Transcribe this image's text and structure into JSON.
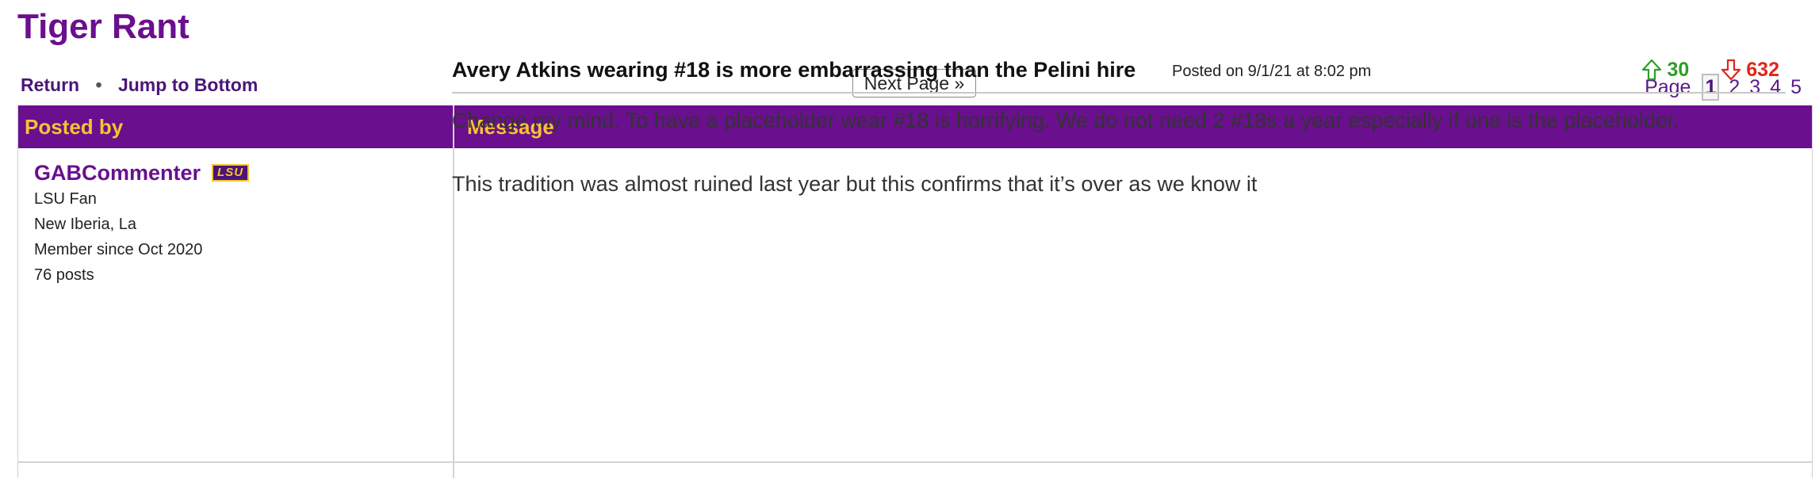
{
  "forum": {
    "title": "Tiger Rant"
  },
  "nav": {
    "return_label": "Return",
    "separator": "•",
    "jump_label": "Jump to Bottom"
  },
  "pager": {
    "next_label": "Next Page »",
    "page_label": "Page",
    "pages": [
      "1",
      "2",
      "3",
      "4",
      "5"
    ],
    "current": "1"
  },
  "table": {
    "posted_by_header": "Posted by",
    "message_header": "Message"
  },
  "author": {
    "name": "GABCommenter",
    "badge": "LSU",
    "fan_of": "LSU Fan",
    "location": "New Iberia, La",
    "member_since": "Member since Oct 2020",
    "posts": "76 posts"
  },
  "post": {
    "title": "Avery Atkins wearing #18 is more embarrassing than the Pelini hire",
    "posted_on": "Posted on 9/1/21 at 8:02 pm",
    "upvotes": "30",
    "downvotes": "632",
    "body": [
      "Change my mind. To have a placeholder wear #18 is horrifying. We do not need 2 #18s a year especially if one is the placeholder.",
      "This tradition was almost ruined last year but this confirms that it’s over as we know it"
    ]
  },
  "colors": {
    "brand_purple": "#6a0f8e",
    "brand_gold": "#f4c430",
    "upvote_green": "#2e9e27",
    "downvote_red": "#e1261c"
  }
}
